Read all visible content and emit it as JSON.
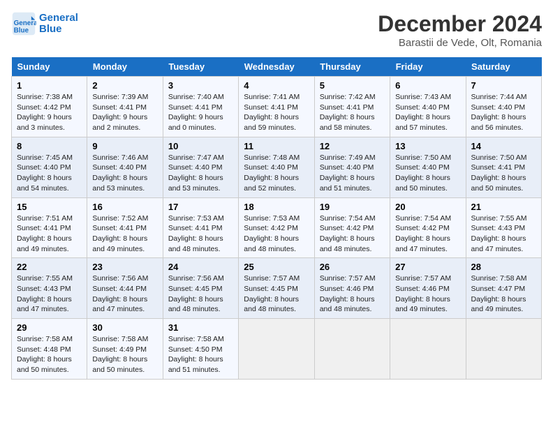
{
  "header": {
    "logo_line1": "General",
    "logo_line2": "Blue",
    "title": "December 2024",
    "location": "Barastii de Vede, Olt, Romania"
  },
  "weekdays": [
    "Sunday",
    "Monday",
    "Tuesday",
    "Wednesday",
    "Thursday",
    "Friday",
    "Saturday"
  ],
  "weeks": [
    [
      {
        "day": "1",
        "sunrise": "7:38 AM",
        "sunset": "4:42 PM",
        "daylight": "9 hours and 3 minutes."
      },
      {
        "day": "2",
        "sunrise": "7:39 AM",
        "sunset": "4:41 PM",
        "daylight": "9 hours and 2 minutes."
      },
      {
        "day": "3",
        "sunrise": "7:40 AM",
        "sunset": "4:41 PM",
        "daylight": "9 hours and 0 minutes."
      },
      {
        "day": "4",
        "sunrise": "7:41 AM",
        "sunset": "4:41 PM",
        "daylight": "8 hours and 59 minutes."
      },
      {
        "day": "5",
        "sunrise": "7:42 AM",
        "sunset": "4:41 PM",
        "daylight": "8 hours and 58 minutes."
      },
      {
        "day": "6",
        "sunrise": "7:43 AM",
        "sunset": "4:40 PM",
        "daylight": "8 hours and 57 minutes."
      },
      {
        "day": "7",
        "sunrise": "7:44 AM",
        "sunset": "4:40 PM",
        "daylight": "8 hours and 56 minutes."
      }
    ],
    [
      {
        "day": "8",
        "sunrise": "7:45 AM",
        "sunset": "4:40 PM",
        "daylight": "8 hours and 54 minutes."
      },
      {
        "day": "9",
        "sunrise": "7:46 AM",
        "sunset": "4:40 PM",
        "daylight": "8 hours and 53 minutes."
      },
      {
        "day": "10",
        "sunrise": "7:47 AM",
        "sunset": "4:40 PM",
        "daylight": "8 hours and 53 minutes."
      },
      {
        "day": "11",
        "sunrise": "7:48 AM",
        "sunset": "4:40 PM",
        "daylight": "8 hours and 52 minutes."
      },
      {
        "day": "12",
        "sunrise": "7:49 AM",
        "sunset": "4:40 PM",
        "daylight": "8 hours and 51 minutes."
      },
      {
        "day": "13",
        "sunrise": "7:50 AM",
        "sunset": "4:40 PM",
        "daylight": "8 hours and 50 minutes."
      },
      {
        "day": "14",
        "sunrise": "7:50 AM",
        "sunset": "4:41 PM",
        "daylight": "8 hours and 50 minutes."
      }
    ],
    [
      {
        "day": "15",
        "sunrise": "7:51 AM",
        "sunset": "4:41 PM",
        "daylight": "8 hours and 49 minutes."
      },
      {
        "day": "16",
        "sunrise": "7:52 AM",
        "sunset": "4:41 PM",
        "daylight": "8 hours and 49 minutes."
      },
      {
        "day": "17",
        "sunrise": "7:53 AM",
        "sunset": "4:41 PM",
        "daylight": "8 hours and 48 minutes."
      },
      {
        "day": "18",
        "sunrise": "7:53 AM",
        "sunset": "4:42 PM",
        "daylight": "8 hours and 48 minutes."
      },
      {
        "day": "19",
        "sunrise": "7:54 AM",
        "sunset": "4:42 PM",
        "daylight": "8 hours and 48 minutes."
      },
      {
        "day": "20",
        "sunrise": "7:54 AM",
        "sunset": "4:42 PM",
        "daylight": "8 hours and 47 minutes."
      },
      {
        "day": "21",
        "sunrise": "7:55 AM",
        "sunset": "4:43 PM",
        "daylight": "8 hours and 47 minutes."
      }
    ],
    [
      {
        "day": "22",
        "sunrise": "7:55 AM",
        "sunset": "4:43 PM",
        "daylight": "8 hours and 47 minutes."
      },
      {
        "day": "23",
        "sunrise": "7:56 AM",
        "sunset": "4:44 PM",
        "daylight": "8 hours and 47 minutes."
      },
      {
        "day": "24",
        "sunrise": "7:56 AM",
        "sunset": "4:45 PM",
        "daylight": "8 hours and 48 minutes."
      },
      {
        "day": "25",
        "sunrise": "7:57 AM",
        "sunset": "4:45 PM",
        "daylight": "8 hours and 48 minutes."
      },
      {
        "day": "26",
        "sunrise": "7:57 AM",
        "sunset": "4:46 PM",
        "daylight": "8 hours and 48 minutes."
      },
      {
        "day": "27",
        "sunrise": "7:57 AM",
        "sunset": "4:46 PM",
        "daylight": "8 hours and 49 minutes."
      },
      {
        "day": "28",
        "sunrise": "7:58 AM",
        "sunset": "4:47 PM",
        "daylight": "8 hours and 49 minutes."
      }
    ],
    [
      {
        "day": "29",
        "sunrise": "7:58 AM",
        "sunset": "4:48 PM",
        "daylight": "8 hours and 50 minutes."
      },
      {
        "day": "30",
        "sunrise": "7:58 AM",
        "sunset": "4:49 PM",
        "daylight": "8 hours and 50 minutes."
      },
      {
        "day": "31",
        "sunrise": "7:58 AM",
        "sunset": "4:50 PM",
        "daylight": "8 hours and 51 minutes."
      },
      null,
      null,
      null,
      null
    ]
  ]
}
